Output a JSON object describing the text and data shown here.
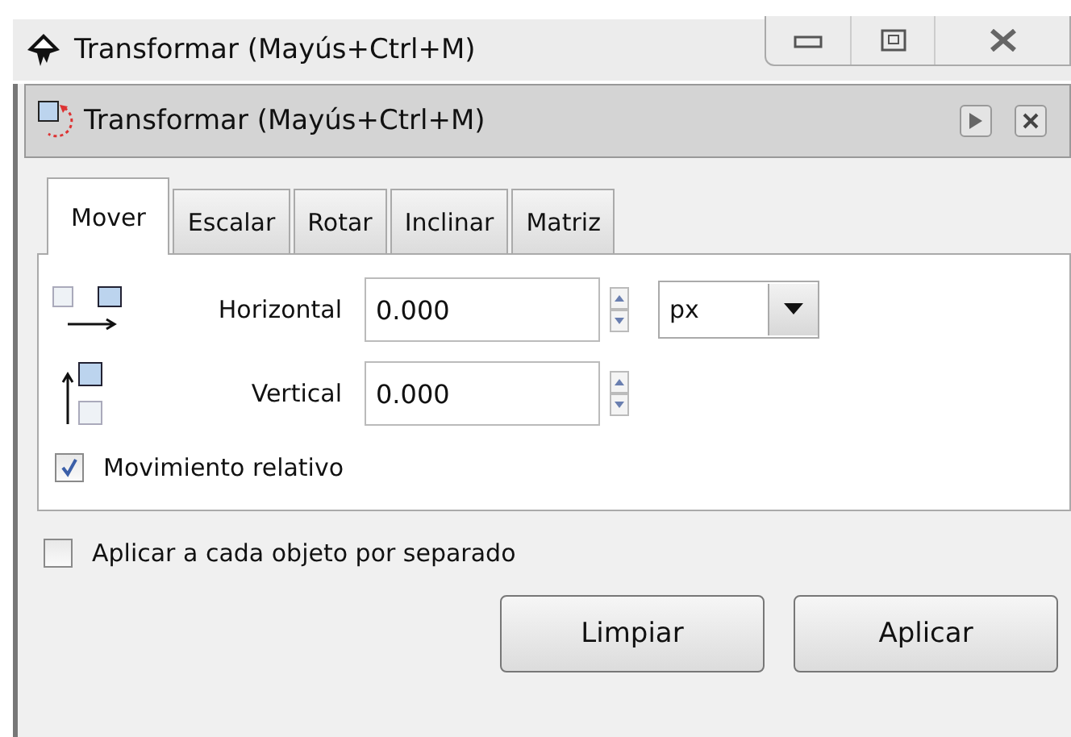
{
  "window": {
    "title": "Transformar (Mayús+Ctrl+M)"
  },
  "panel": {
    "title": "Transformar (Mayús+Ctrl+M)"
  },
  "tabs": [
    {
      "label": "Mover",
      "selected": true
    },
    {
      "label": "Escalar",
      "selected": false
    },
    {
      "label": "Rotar",
      "selected": false
    },
    {
      "label": "Inclinar",
      "selected": false
    },
    {
      "label": "Matriz",
      "selected": false
    }
  ],
  "fields": [
    {
      "kind": "horizontal",
      "label": "Horizontal",
      "value": "0.000",
      "unit": "px"
    },
    {
      "kind": "vertical",
      "label": "Vertical",
      "value": "0.000"
    }
  ],
  "relative_move": {
    "label": "Movimiento relativo",
    "checked": true
  },
  "apply_each": {
    "label": "Aplicar a cada objeto por separado",
    "checked": false
  },
  "buttons": [
    "Limpiar",
    "Aplicar"
  ]
}
